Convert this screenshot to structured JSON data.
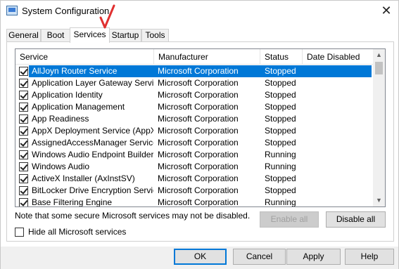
{
  "window": {
    "title": "System Configuration",
    "close_glyph": "✕"
  },
  "tabs": [
    {
      "label": "General"
    },
    {
      "label": "Boot"
    },
    {
      "label": "Services"
    },
    {
      "label": "Startup"
    },
    {
      "label": "Tools"
    }
  ],
  "active_tab": "Services",
  "annotation_color": "#e03030",
  "services": {
    "columns": {
      "service": "Service",
      "manufacturer": "Manufacturer",
      "status": "Status",
      "date_disabled": "Date Disabled"
    },
    "rows": [
      {
        "name": "AllJoyn Router Service",
        "manufacturer": "Microsoft Corporation",
        "status": "Stopped",
        "date_disabled": "",
        "checked": true,
        "selected": true
      },
      {
        "name": "Application Layer Gateway Service",
        "manufacturer": "Microsoft Corporation",
        "status": "Stopped",
        "date_disabled": "",
        "checked": true
      },
      {
        "name": "Application Identity",
        "manufacturer": "Microsoft Corporation",
        "status": "Stopped",
        "date_disabled": "",
        "checked": true
      },
      {
        "name": "Application Management",
        "manufacturer": "Microsoft Corporation",
        "status": "Stopped",
        "date_disabled": "",
        "checked": true
      },
      {
        "name": "App Readiness",
        "manufacturer": "Microsoft Corporation",
        "status": "Stopped",
        "date_disabled": "",
        "checked": true
      },
      {
        "name": "AppX Deployment Service (AppX...",
        "manufacturer": "Microsoft Corporation",
        "status": "Stopped",
        "date_disabled": "",
        "checked": true
      },
      {
        "name": "AssignedAccessManager Service",
        "manufacturer": "Microsoft Corporation",
        "status": "Stopped",
        "date_disabled": "",
        "checked": true
      },
      {
        "name": "Windows Audio Endpoint Builder",
        "manufacturer": "Microsoft Corporation",
        "status": "Running",
        "date_disabled": "",
        "checked": true
      },
      {
        "name": "Windows Audio",
        "manufacturer": "Microsoft Corporation",
        "status": "Running",
        "date_disabled": "",
        "checked": true
      },
      {
        "name": "ActiveX Installer (AxInstSV)",
        "manufacturer": "Microsoft Corporation",
        "status": "Stopped",
        "date_disabled": "",
        "checked": true
      },
      {
        "name": "BitLocker Drive Encryption Service",
        "manufacturer": "Microsoft Corporation",
        "status": "Stopped",
        "date_disabled": "",
        "checked": true
      },
      {
        "name": "Base Filtering Engine",
        "manufacturer": "Microsoft Corporation",
        "status": "Running",
        "date_disabled": "",
        "checked": true
      }
    ]
  },
  "note": "Note that some secure Microsoft services may not be disabled.",
  "buttons": {
    "enable_all": "Enable all",
    "disable_all": "Disable all",
    "ok": "OK",
    "cancel": "Cancel",
    "apply": "Apply",
    "help": "Help"
  },
  "hide_ms_label": "Hide all Microsoft services",
  "hide_ms_checked": false,
  "icons": {
    "scroll_up": "▲",
    "scroll_down": "▼"
  }
}
